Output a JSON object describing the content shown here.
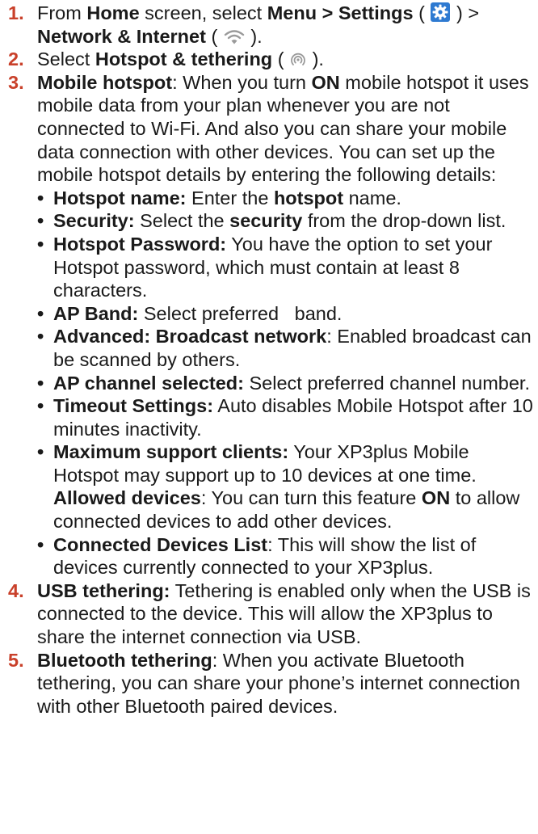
{
  "steps": [
    {
      "number": "1.",
      "t1": "From ",
      "home": "Home",
      "t2": " screen, select ",
      "menu_path": "Menu > Settings",
      "t3": " ( ",
      "t4": " ) > ",
      "network": "Network & Internet",
      "t5": " ( ",
      "t6": " )."
    },
    {
      "number": "2.",
      "t1": "Select ",
      "hotspot_tethering": "Hotspot & tethering",
      "t2": " ( ",
      "t3": " )."
    },
    {
      "number": "3.",
      "label": "Mobile hotspot",
      "t1": ": When you turn ",
      "on": "ON",
      "t2": " mobile hotspot it uses mobile data from your plan whenever you are not connected to Wi-Fi. And also you can share your mobile data connection with other devices. You can set up the mobile hotspot details by entering the following details:"
    },
    {
      "number": "4.",
      "label": "USB tethering:",
      "text": " Tethering is enabled only when the USB is connected to the device. This will allow the XP3plus to share the internet connection via USB."
    },
    {
      "number": "5.",
      "label": "Bluetooth tethering",
      "text": ": When you activate Bluetooth tethering, you can share your phone’s internet connection with other Bluetooth paired devices."
    }
  ],
  "bullets": [
    {
      "label": "Hotspot name:",
      "t1": " Enter the ",
      "bold": "hotspot",
      "t2": " name."
    },
    {
      "label": "Security:",
      "t1": " Select the ",
      "bold": "security",
      "t2": " from the drop-down list."
    },
    {
      "label": "Hotspot Password:",
      "text": " You have the option to set your Hotspot password, which must contain at least 8 characters."
    },
    {
      "label": "AP Band:",
      "text": " Select preferred   band."
    },
    {
      "label": "Advanced: Broadcast network",
      "text": ":  Enabled broadcast can be scanned by others."
    },
    {
      "label": "AP channel selected:",
      "text": " Select preferred channel number."
    },
    {
      "label": "Timeout Settings:",
      "text": " Auto disables Mobile Hotspot after 10 minutes inactivity."
    },
    {
      "label": "Maximum support clients:",
      "text": " Your XP3plus Mobile Hotspot may support up to 10 devices at one time.",
      "sub_label": "Allowed devices",
      "sub_t1": ": You can turn this feature ",
      "sub_on": "ON",
      "sub_t2": " to allow connected devices to add other devices."
    },
    {
      "label": "Connected Devices List",
      "text": ": This will show the list of devices currently connected to your XP3plus."
    }
  ],
  "bullet_glyph": "•",
  "icons": {
    "settings": "settings-gear-icon",
    "network": "wifi-icon",
    "hotspot": "hotspot-icon"
  },
  "colors": {
    "step_number": "#c9402a",
    "settings_icon_bg": "#2e7ad1",
    "text": "#1a1a1a"
  }
}
